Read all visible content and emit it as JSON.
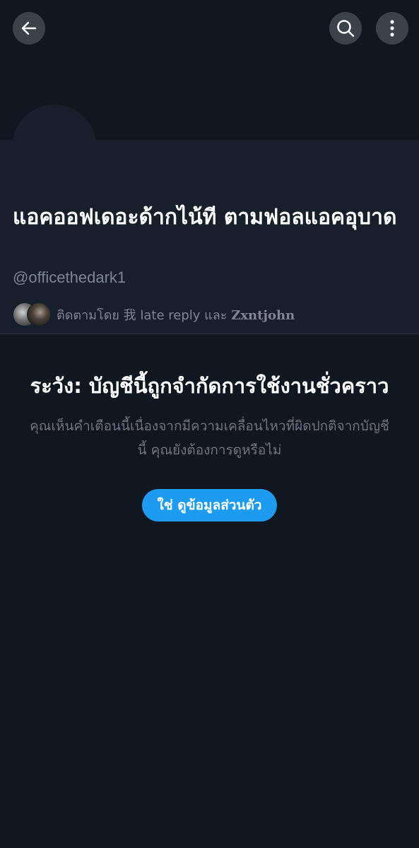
{
  "header": {
    "back_icon": "arrow-left-icon",
    "search_icon": "search-icon",
    "more_icon": "more-vertical-icon"
  },
  "profile": {
    "display_name": "แอคออฟเดอะด้ากไน้ที ตามฟอลแอคอุบาด",
    "handle": "@officethedark1",
    "followed_by_prefix": "ติดตามโดย 我 late reply และ ",
    "followed_by_user2": "Zxntjohn"
  },
  "warning": {
    "title": "ระวัง: บัญชีนี้ถูกจำกัดการใช้งานชั่วคราว",
    "body": "คุณเห็นคำเตือนนี้เนื่องจากมีความเคลื่อนไหวที่ผิดปกติจากบัญชีนี้ คุณยังต้องการดูหรือไม่",
    "button_label": "ใช่ ดูข้อมูลส่วนตัว"
  },
  "colors": {
    "background": "#111720",
    "profile_bg": "#17202a",
    "accent": "#1d9bf0",
    "secondary_text": "#7d8791"
  }
}
